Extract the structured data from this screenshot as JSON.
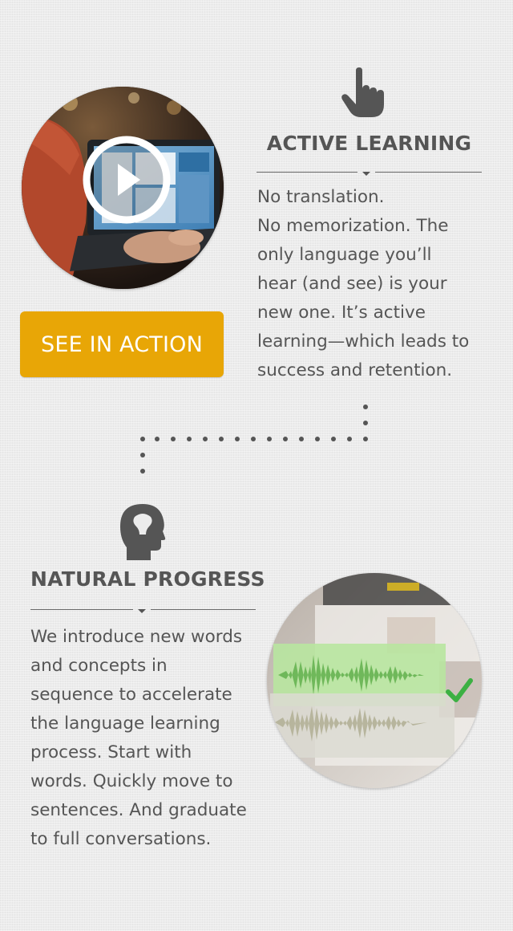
{
  "active_learning": {
    "title": "ACTIVE LEARNING",
    "body_lines": [
      "No translation.",
      "No memorization. The",
      "only language you’ll",
      "hear (and see) is your",
      "new one. It’s active",
      "learning—which leads to",
      "success and retention."
    ],
    "cta_label": "SEE IN ACTION",
    "icon": "pointer-hand-icon"
  },
  "natural_progress": {
    "title": "NATURAL PROGRESS",
    "body_lines": [
      "We introduce new words",
      "and concepts in",
      "sequence to accelerate",
      "the language learning",
      "process. Start with",
      "words. Quickly move to",
      "sentences. And graduate",
      "to full conversations."
    ],
    "icon": "head-profile-icon"
  },
  "colors": {
    "background": "#ececec",
    "text": "#555555",
    "cta": "#e8a606",
    "cta_text": "#ffffff",
    "check": "#3cb043",
    "waveform_green": "#8fcc78"
  },
  "icons": {
    "play": "play-icon",
    "check": "checkmark-icon"
  }
}
